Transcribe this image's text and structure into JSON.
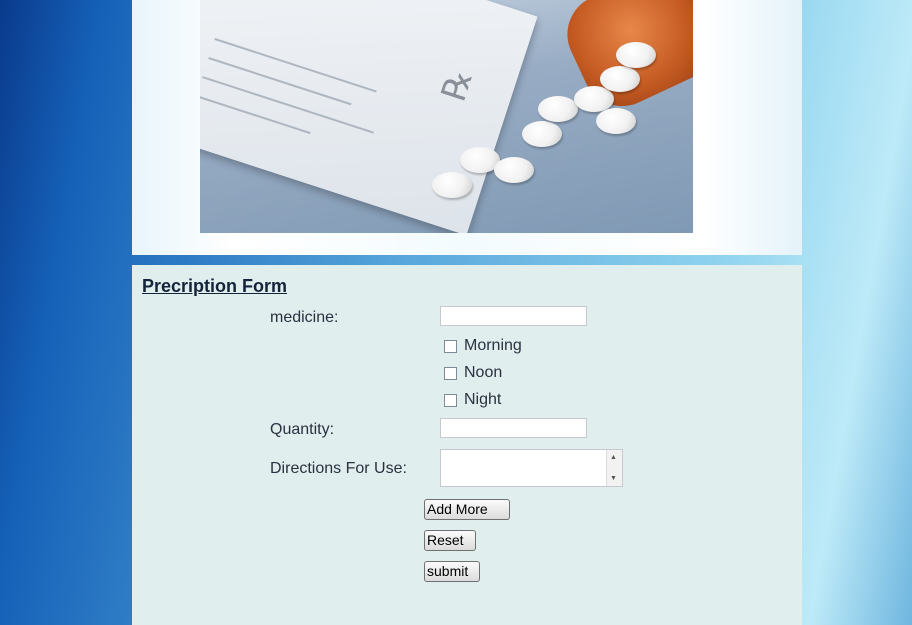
{
  "form": {
    "title": "Precription Form",
    "medicine_label": "medicine:",
    "medicine_value": "",
    "times": [
      {
        "label": "Morning",
        "checked": false
      },
      {
        "label": "Noon",
        "checked": false
      },
      {
        "label": "Night",
        "checked": false
      }
    ],
    "quantity_label": "Quantity:",
    "quantity_value": "",
    "directions_label": "Directions For Use:",
    "directions_value": "",
    "add_more_label": "Add More",
    "reset_label": "Reset",
    "submit_label": "submit"
  },
  "colors": {
    "panel_bg": "#e0eeee",
    "title_color": "#14243a",
    "bottle_orange": "#c45a22"
  }
}
